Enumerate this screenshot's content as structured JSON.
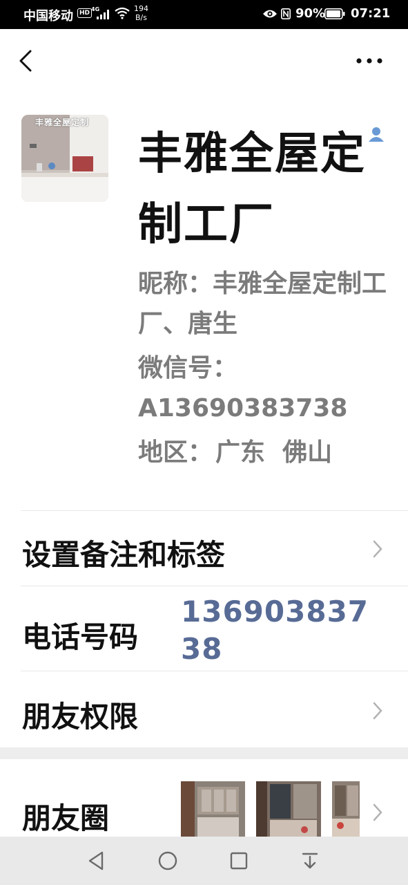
{
  "status_bar": {
    "carrier": "中国移动",
    "hd_badge": "HD",
    "network": "4G",
    "speed_value": "194",
    "speed_unit": "B/s",
    "battery": "90%",
    "time": "07:21"
  },
  "profile": {
    "name": "丰雅全屋定制工厂",
    "avatar_caption": "丰雅全屋定制",
    "nickname": "昵称：丰雅全屋定制工厂、唐生",
    "wechat_id": "微信号：A13690383738",
    "region_label": "地区：",
    "region_value": "广东  佛山"
  },
  "rows": {
    "remark_label": "设置备注和标签",
    "phone_label": "电话号码",
    "phone_value": "13690383738",
    "privacy_label": "朋友权限",
    "moments_label": "朋友圈"
  },
  "colors": {
    "link": "#576b95",
    "secondary_text": "#7b7b7b",
    "section_gap": "#ededed",
    "nav_bar": "#e9e9e9"
  },
  "icons": {
    "back": "back-arrow-icon",
    "more": "more-dots-icon",
    "contact": "contact-person-icon",
    "chevron": "chevron-right-icon",
    "nav_back": "triangle-back-icon",
    "nav_home": "circle-home-icon",
    "nav_recent": "square-recent-icon",
    "nav_down": "arrow-down-icon"
  }
}
